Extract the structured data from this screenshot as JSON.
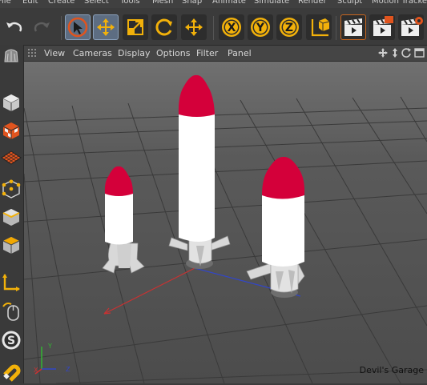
{
  "menubar": {
    "items": [
      "File",
      "Edit",
      "Create",
      "Select",
      "Tools",
      "Mesh",
      "Snap",
      "Animate",
      "Simulate",
      "Render",
      "Sculpt",
      "Motion Tracker"
    ]
  },
  "toolbar": {
    "axis_x": "X",
    "axis_y": "Y",
    "axis_z": "Z"
  },
  "viewport_menu": {
    "items": [
      "View",
      "Cameras",
      "Display",
      "Options",
      "Filter",
      "Panel"
    ]
  },
  "viewport": {
    "axis_x": "X",
    "axis_y": "Y",
    "axis_z": "Z",
    "watermark": "Devil's Garage"
  },
  "colors": {
    "rocket_nose": "#d4003a",
    "rocket_body": "#ffffff",
    "accent_select": "#5d6d82",
    "axis_x": "#c83232",
    "axis_y": "#32b432",
    "axis_z": "#3246c8"
  }
}
